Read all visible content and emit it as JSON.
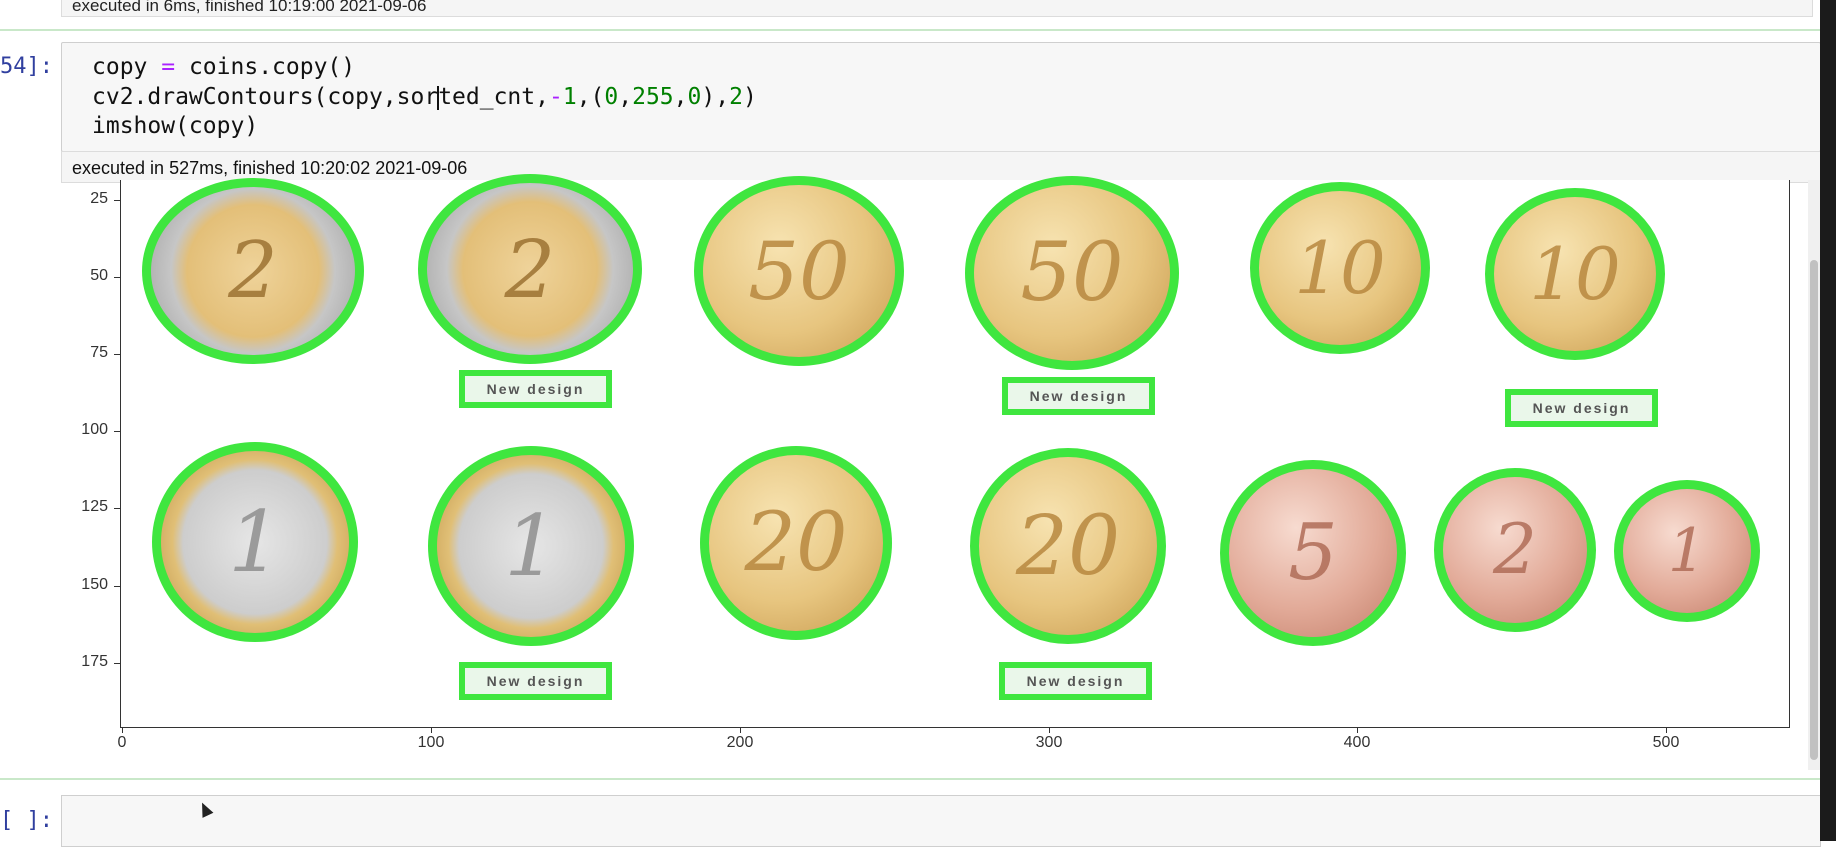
{
  "prev_cell": {
    "exec_text": "executed in 6ms, finished 10:19:00 2021-09-06"
  },
  "cell": {
    "prompt": "54]:",
    "code_lines": [
      "copy = coins.copy()",
      "cv2.drawContours(copy,sorted_cnt,-1,(0,255,0),2)",
      "imshow(copy)"
    ],
    "exec_text": "executed in 527ms, finished 10:20:02 2021-09-06"
  },
  "plot": {
    "y_ticks": [
      "25",
      "50",
      "75",
      "100",
      "125",
      "150",
      "175"
    ],
    "x_ticks": [
      "0",
      "100",
      "200",
      "300",
      "400",
      "500"
    ],
    "coins": [
      "2",
      "2",
      "50",
      "50",
      "10",
      "10",
      "1",
      "1",
      "20",
      "20",
      "5",
      "2",
      "1"
    ],
    "badge_text": "New design"
  },
  "next_cell": {
    "prompt": "[ ]:"
  },
  "colors": {
    "contour": "#3fe63f",
    "prompt": "#303f9f"
  },
  "icons": [
    "mouse-cursor-icon"
  ]
}
